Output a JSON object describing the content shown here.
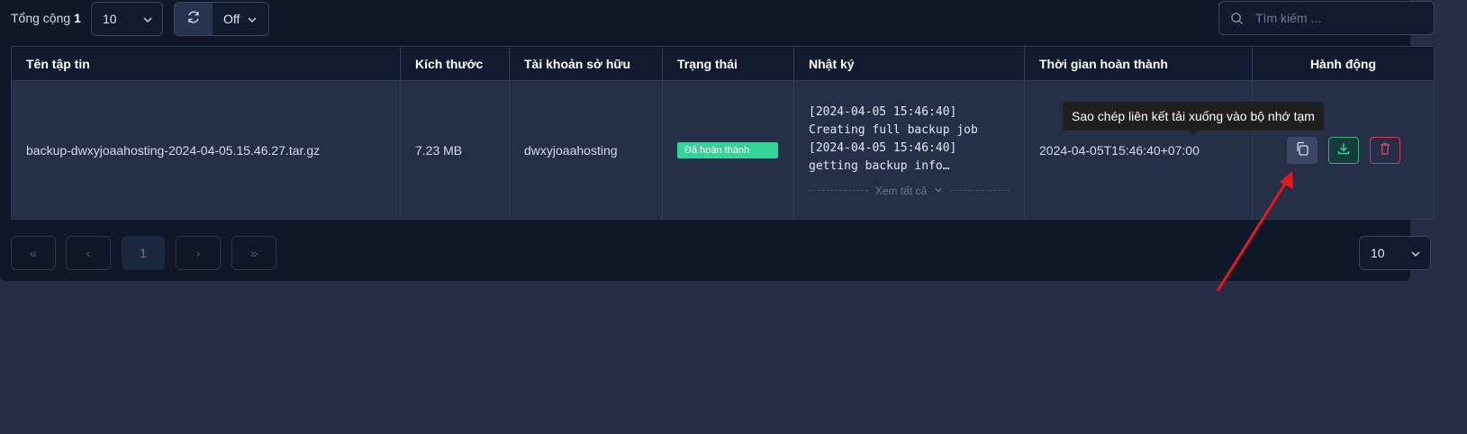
{
  "toolbar": {
    "total_label": "Tổng cộng",
    "total_count": "1",
    "page_size": "10",
    "refresh_interval": "Off",
    "search_placeholder": "Tìm kiếm ..."
  },
  "table": {
    "columns": [
      "Tên tập tin",
      "Kích thước",
      "Tài khoản sở hữu",
      "Trạng thái",
      "Nhật ký",
      "Thời gian hoàn thành",
      "Hành động"
    ],
    "rows": [
      {
        "filename": "backup-dwxyjoaahosting-2024-04-05.15.46.27.tar.gz",
        "size": "7.23 MB",
        "owner": "dwxyjoaahosting",
        "status": "Đã hoàn thành",
        "log_lines": [
          "[2024-04-05 15:46:40]",
          "Creating full backup job",
          "[2024-04-05 15:46:40]",
          "getting backup info…"
        ],
        "log_more": "Xem tất cả",
        "completed_at": "2024-04-05T15:46:40+07:00"
      }
    ]
  },
  "tooltip": "Sao chép liên kết tải xuống vào bộ nhớ tạm",
  "pagination": {
    "first": "«",
    "prev": "‹",
    "current": "1",
    "next": "›",
    "last": "»",
    "page_size": "10"
  },
  "colors": {
    "background": "#262e45",
    "panel": "#0f1729",
    "status_success": "#34d399",
    "delete": "#d23c55",
    "download": "#2fb07a",
    "annotation_arrow": "#e8191b"
  },
  "icons": [
    "search-icon",
    "refresh-icon",
    "chevron-down-icon",
    "copy-icon",
    "download-icon",
    "trash-icon"
  ]
}
